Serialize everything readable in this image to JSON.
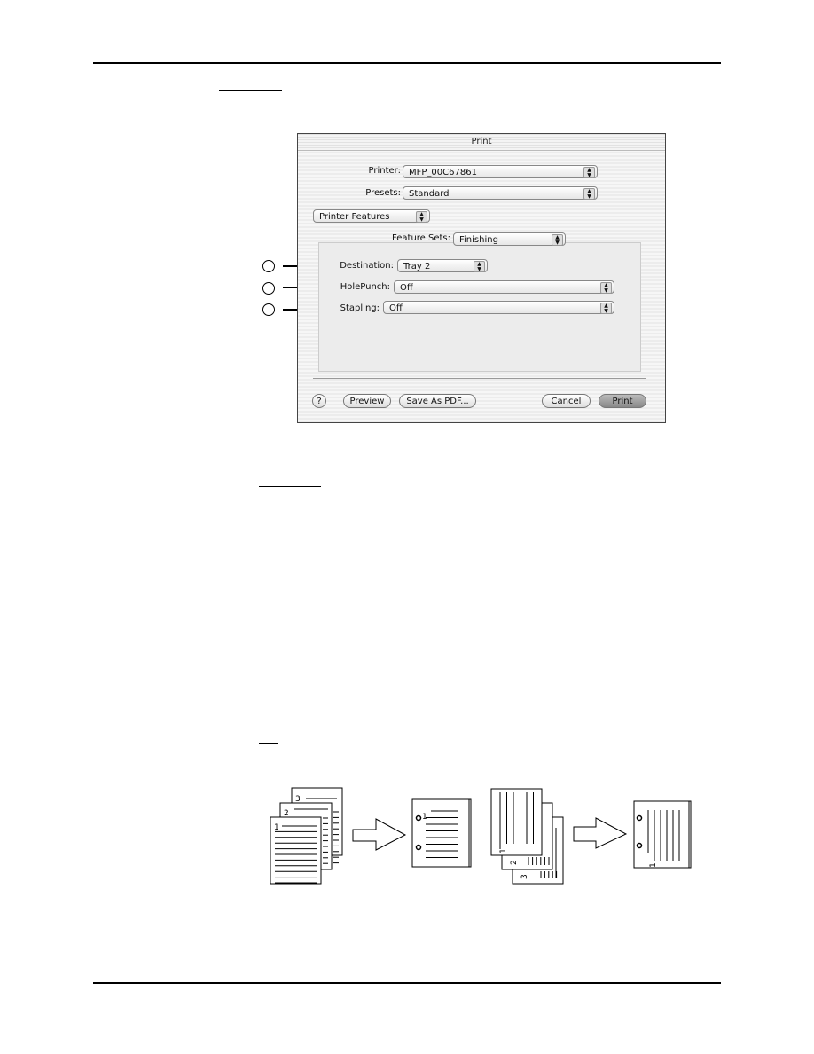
{
  "dialog": {
    "title": "Print",
    "printer_label": "Printer:",
    "printer_value": "MFP_00C67861",
    "presets_label": "Presets:",
    "presets_value": "Standard",
    "panel_value": "Printer Features",
    "feature_sets_label": "Feature Sets:",
    "feature_sets_value": "Finishing",
    "destination_label": "Destination:",
    "destination_value": "Tray 2",
    "holepunch_label": "HolePunch:",
    "holepunch_value": "Off",
    "stapling_label": "Stapling:",
    "stapling_value": "Off",
    "help_label": "?",
    "preview_label": "Preview",
    "save_pdf_label": "Save As PDF...",
    "cancel_label": "Cancel",
    "print_label": "Print"
  },
  "illustration": {
    "sheet_numbers": [
      "1",
      "2",
      "3"
    ]
  }
}
